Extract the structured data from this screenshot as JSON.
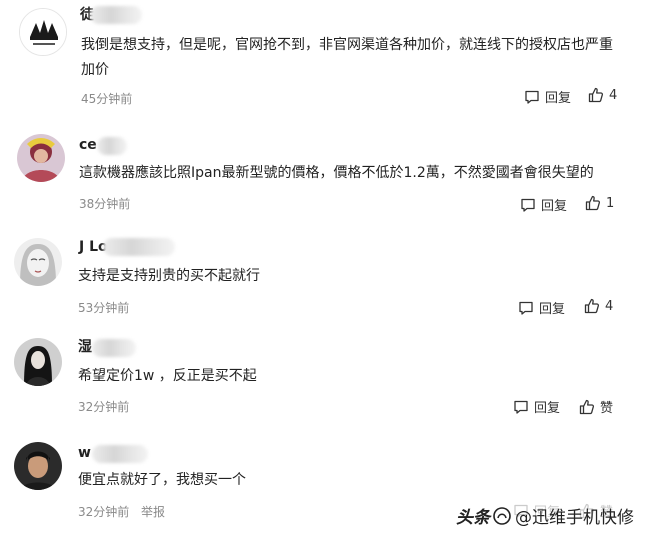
{
  "comments": [
    {
      "name_visible": "徒",
      "text": "我倒是想支持，但是呢，官网抢不到，非官网渠道各种加价，就连线下的授权店也严重加价",
      "time": "45分钟前",
      "reply_label": "回复",
      "like_label": "4"
    },
    {
      "name_visible": "ce",
      "text": "這款機器應該比照Ipan最新型號的價格，價格不低於1.2萬，不然愛國者會很失望的",
      "time": "38分钟前",
      "reply_label": "回复",
      "like_label": "1"
    },
    {
      "name_visible": "J Lo",
      "text": "支持是支持别贵的买不起就行",
      "time": "53分钟前",
      "reply_label": "回复",
      "like_label": "4"
    },
    {
      "name_visible": "湿",
      "text": "希望定价1w ，反正是买不起",
      "time": "32分钟前",
      "reply_label": "回复",
      "like_label": "赞"
    },
    {
      "name_visible": "w",
      "text": "便宜点就好了，我想买一个",
      "time": "32分钟前",
      "report_label": "举报",
      "reply_label": "回复",
      "like_label": "赞"
    }
  ],
  "watermark": {
    "brand": "头条",
    "account": "@迅维手机快修"
  },
  "colors": {
    "text": "#222222",
    "meta": "#8a8a8a"
  }
}
